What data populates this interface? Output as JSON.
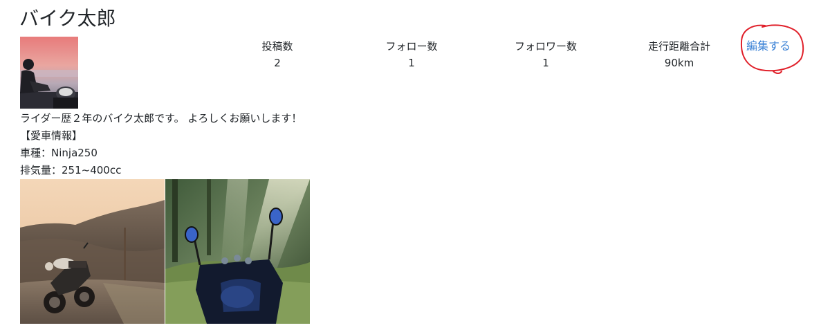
{
  "profile": {
    "username": "バイク太郎",
    "edit_label": "編集する",
    "stats": {
      "posts": {
        "label": "投稿数",
        "value": "2"
      },
      "follow": {
        "label": "フォロー数",
        "value": "1"
      },
      "followers": {
        "label": "フォロワー数",
        "value": "1"
      },
      "distance": {
        "label": "走行距離合計",
        "value": "90km"
      }
    },
    "bio": {
      "line1": "ライダー歴２年のバイク太郎です。 よろしくお願いします！",
      "line2": "【愛車情報】",
      "line3": "車種：Ninja250",
      "line4": "排気量：251~400cc"
    }
  },
  "posts": [
    {
      "image": "motorcycle-sunset-road-photo"
    },
    {
      "image": "motorcycle-forest-sunbeam-photo"
    }
  ],
  "colors": {
    "text": "#212529",
    "link": "#3b82d6",
    "annotation": "#e0202a"
  }
}
